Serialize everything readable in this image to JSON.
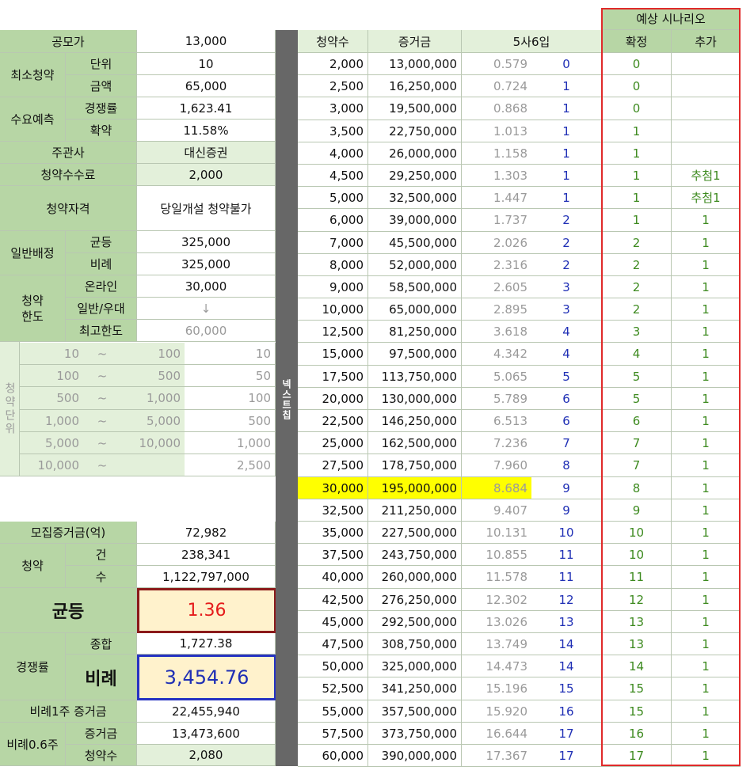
{
  "left": {
    "ipo_price_label": "공모가",
    "ipo_price": "13,000",
    "min_sub_label": "최소청약",
    "unit_label": "단위",
    "unit": "10",
    "amount_label": "금액",
    "amount": "65,000",
    "demand_label": "수요예측",
    "competition_label": "경쟁률",
    "competition": "1,623.41",
    "commit_label": "확약",
    "commit": "11.58%",
    "manager_label": "주관사",
    "manager": "대신증권",
    "fee_label": "청약수수료",
    "fee": "2,000",
    "eligibility_label": "청약자격",
    "eligibility": "당일개설 청약불가",
    "general_alloc_label": "일반배정",
    "equal_label": "균등",
    "equal": "325,000",
    "prop_label": "비례",
    "prop": "325,000",
    "limit_label": "청약\n한도",
    "online_label": "온라인",
    "online": "30,000",
    "general_pref_label": "일반/우대",
    "general_pref": "↓",
    "max_label": "최고한도",
    "max": "60,000",
    "units_side_label": "청약단위",
    "unit_rows": [
      {
        "from": "10",
        "tilde": "~",
        "to": "100",
        "unit": "10"
      },
      {
        "from": "100",
        "tilde": "~",
        "to": "500",
        "unit": "50"
      },
      {
        "from": "500",
        "tilde": "~",
        "to": "1,000",
        "unit": "100"
      },
      {
        "from": "1,000",
        "tilde": "~",
        "to": "5,000",
        "unit": "500"
      },
      {
        "from": "5,000",
        "tilde": "~",
        "to": "10,000",
        "unit": "1,000"
      },
      {
        "from": "10,000",
        "tilde": "~",
        "to": "",
        "unit": "2,500"
      }
    ],
    "raised_label": "모집증거금(억)",
    "raised": "72,982",
    "sub_label": "청약",
    "count_label": "건",
    "count": "238,341",
    "shares_label": "수",
    "shares": "1,122,797,000",
    "equal_big_label": "균등",
    "equal_big": "1.36",
    "ratio_label": "경쟁률",
    "total_label": "종합",
    "total": "1,727.38",
    "prop_big_label": "비례",
    "prop_big": "3,454.76",
    "prop1_label": "비례1주 증거금",
    "prop1": "22,455,940",
    "prop06_label": "비례0.6주",
    "deposit_label": "증거금",
    "deposit": "13,473,600",
    "subcount_label": "청약수",
    "subcount": "2,080"
  },
  "separator_label": "넥스트칩",
  "right": {
    "scenario_title": "예상 시나리오",
    "headers": {
      "sub": "청약수",
      "deposit": "증거금",
      "rule": "5사6입",
      "confirm": "확정",
      "extra": "추가"
    },
    "rows": [
      {
        "sub": "2,000",
        "dep": "13,000,000",
        "ratio": "0.579",
        "r": "0",
        "c": "0",
        "e": ""
      },
      {
        "sub": "2,500",
        "dep": "16,250,000",
        "ratio": "0.724",
        "r": "1",
        "c": "0",
        "e": ""
      },
      {
        "sub": "3,000",
        "dep": "19,500,000",
        "ratio": "0.868",
        "r": "1",
        "c": "0",
        "e": ""
      },
      {
        "sub": "3,500",
        "dep": "22,750,000",
        "ratio": "1.013",
        "r": "1",
        "c": "1",
        "e": ""
      },
      {
        "sub": "4,000",
        "dep": "26,000,000",
        "ratio": "1.158",
        "r": "1",
        "c": "1",
        "e": ""
      },
      {
        "sub": "4,500",
        "dep": "29,250,000",
        "ratio": "1.303",
        "r": "1",
        "c": "1",
        "e": "추첨1"
      },
      {
        "sub": "5,000",
        "dep": "32,500,000",
        "ratio": "1.447",
        "r": "1",
        "c": "1",
        "e": "추첨1"
      },
      {
        "sub": "6,000",
        "dep": "39,000,000",
        "ratio": "1.737",
        "r": "2",
        "c": "1",
        "e": "1"
      },
      {
        "sub": "7,000",
        "dep": "45,500,000",
        "ratio": "2.026",
        "r": "2",
        "c": "2",
        "e": "1"
      },
      {
        "sub": "8,000",
        "dep": "52,000,000",
        "ratio": "2.316",
        "r": "2",
        "c": "2",
        "e": "1"
      },
      {
        "sub": "9,000",
        "dep": "58,500,000",
        "ratio": "2.605",
        "r": "3",
        "c": "2",
        "e": "1"
      },
      {
        "sub": "10,000",
        "dep": "65,000,000",
        "ratio": "2.895",
        "r": "3",
        "c": "2",
        "e": "1"
      },
      {
        "sub": "12,500",
        "dep": "81,250,000",
        "ratio": "3.618",
        "r": "4",
        "c": "3",
        "e": "1"
      },
      {
        "sub": "15,000",
        "dep": "97,500,000",
        "ratio": "4.342",
        "r": "4",
        "c": "4",
        "e": "1"
      },
      {
        "sub": "17,500",
        "dep": "113,750,000",
        "ratio": "5.065",
        "r": "5",
        "c": "5",
        "e": "1"
      },
      {
        "sub": "20,000",
        "dep": "130,000,000",
        "ratio": "5.789",
        "r": "6",
        "c": "5",
        "e": "1"
      },
      {
        "sub": "22,500",
        "dep": "146,250,000",
        "ratio": "6.513",
        "r": "6",
        "c": "6",
        "e": "1"
      },
      {
        "sub": "25,000",
        "dep": "162,500,000",
        "ratio": "7.236",
        "r": "7",
        "c": "7",
        "e": "1"
      },
      {
        "sub": "27,500",
        "dep": "178,750,000",
        "ratio": "7.960",
        "r": "8",
        "c": "7",
        "e": "1"
      },
      {
        "sub": "30,000",
        "dep": "195,000,000",
        "ratio": "8.684",
        "r": "9",
        "c": "8",
        "e": "1",
        "highlight": true
      },
      {
        "sub": "32,500",
        "dep": "211,250,000",
        "ratio": "9.407",
        "r": "9",
        "c": "9",
        "e": "1"
      },
      {
        "sub": "35,000",
        "dep": "227,500,000",
        "ratio": "10.131",
        "r": "10",
        "c": "10",
        "e": "1"
      },
      {
        "sub": "37,500",
        "dep": "243,750,000",
        "ratio": "10.855",
        "r": "11",
        "c": "10",
        "e": "1"
      },
      {
        "sub": "40,000",
        "dep": "260,000,000",
        "ratio": "11.578",
        "r": "11",
        "c": "11",
        "e": "1"
      },
      {
        "sub": "42,500",
        "dep": "276,250,000",
        "ratio": "12.302",
        "r": "12",
        "c": "12",
        "e": "1"
      },
      {
        "sub": "45,000",
        "dep": "292,500,000",
        "ratio": "13.026",
        "r": "13",
        "c": "13",
        "e": "1"
      },
      {
        "sub": "47,500",
        "dep": "308,750,000",
        "ratio": "13.749",
        "r": "14",
        "c": "13",
        "e": "1"
      },
      {
        "sub": "50,000",
        "dep": "325,000,000",
        "ratio": "14.473",
        "r": "14",
        "c": "14",
        "e": "1"
      },
      {
        "sub": "52,500",
        "dep": "341,250,000",
        "ratio": "15.196",
        "r": "15",
        "c": "15",
        "e": "1"
      },
      {
        "sub": "55,000",
        "dep": "357,500,000",
        "ratio": "15.920",
        "r": "16",
        "c": "15",
        "e": "1"
      },
      {
        "sub": "57,500",
        "dep": "373,750,000",
        "ratio": "16.644",
        "r": "17",
        "c": "16",
        "e": "1"
      },
      {
        "sub": "60,000",
        "dep": "390,000,000",
        "ratio": "17.367",
        "r": "17",
        "c": "17",
        "e": "1"
      }
    ]
  }
}
